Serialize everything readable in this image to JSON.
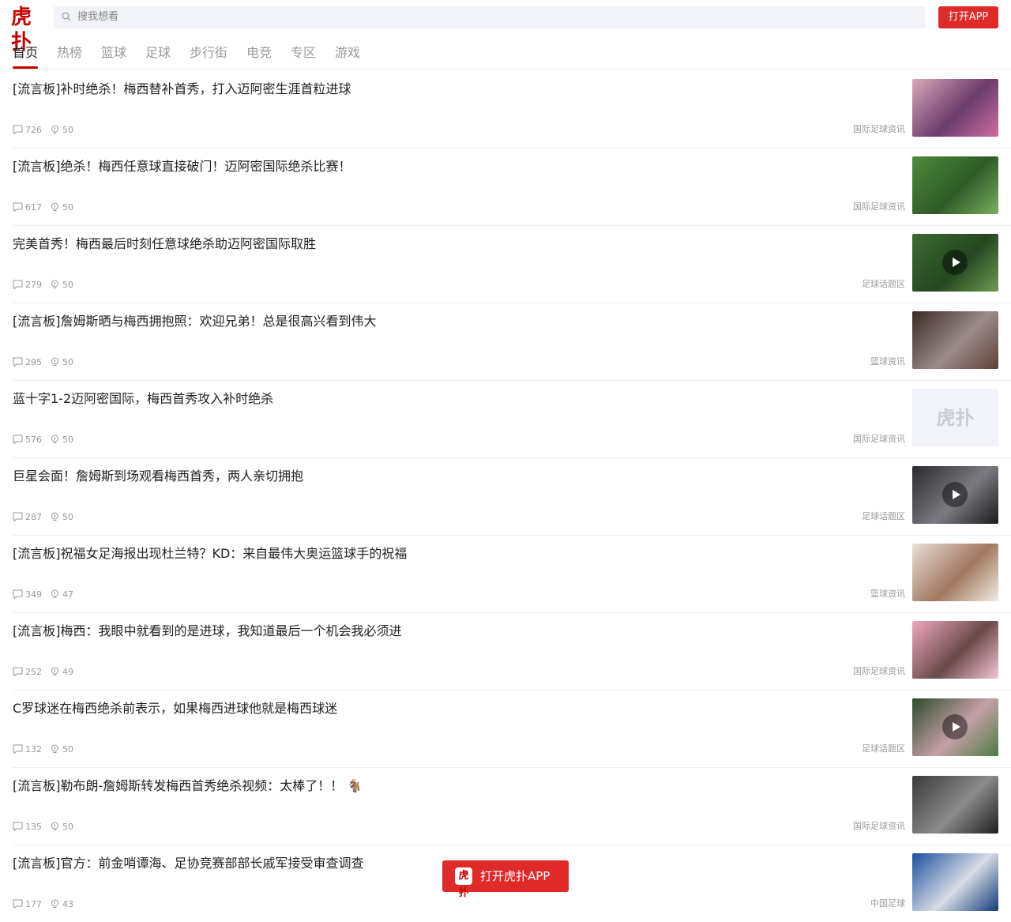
{
  "header": {
    "logo_text": "虎扑",
    "search_placeholder": "搜我想看",
    "open_app_label": "打开APP"
  },
  "tabs": [
    {
      "label": "首页",
      "active": true
    },
    {
      "label": "热榜"
    },
    {
      "label": "篮球"
    },
    {
      "label": "足球"
    },
    {
      "label": "步行街"
    },
    {
      "label": "电竞"
    },
    {
      "label": "专区"
    },
    {
      "label": "游戏"
    }
  ],
  "feed": [
    {
      "title": "[流言板]补时绝杀！梅西替补首秀，打入迈阿密生涯首粒进球",
      "comments": "726",
      "lights": "50",
      "source": "国际足球资讯",
      "thumb": {
        "colors": [
          "#d9a9b8",
          "#6a3c6b",
          "#ce6fa0"
        ],
        "video": false
      }
    },
    {
      "title": "[流言板]绝杀！梅西任意球直接破门！迈阿密国际绝杀比赛！",
      "comments": "617",
      "lights": "50",
      "source": "国际足球资讯",
      "thumb": {
        "colors": [
          "#4f8a3c",
          "#2f5a28",
          "#7cae5c"
        ],
        "video": false
      }
    },
    {
      "title": "完美首秀！梅西最后时刻任意球绝杀助迈阿密国际取胜",
      "comments": "279",
      "lights": "50",
      "source": "足球话题区",
      "thumb": {
        "colors": [
          "#3d6b34",
          "#254620",
          "#6e9a52"
        ],
        "video": true
      }
    },
    {
      "title": "[流言板]詹姆斯晒与梅西拥抱照：欢迎兄弟！总是很高兴看到伟大",
      "comments": "295",
      "lights": "50",
      "source": "篮球资讯",
      "thumb": {
        "colors": [
          "#3b2a24",
          "#9a8a8a",
          "#5c4236"
        ],
        "video": false
      }
    },
    {
      "title": "蓝十字1-2迈阿密国际，梅西首秀攻入补时绝杀",
      "comments": "576",
      "lights": "50",
      "source": "国际足球资讯",
      "thumb": {
        "colors": [
          "#f1f3f8",
          "#f1f3f8",
          "#f1f3f8"
        ],
        "video": false,
        "placeholder": "虎扑"
      }
    },
    {
      "title": "巨星会面！詹姆斯到场观看梅西首秀，两人亲切拥抱",
      "comments": "287",
      "lights": "50",
      "source": "足球话题区",
      "thumb": {
        "colors": [
          "#2a2a2e",
          "#7a7a80",
          "#1b1b1e"
        ],
        "video": true
      }
    },
    {
      "title": "[流言板]祝福女足海报出现杜兰特？KD：来自最伟大奥运篮球手的祝福",
      "comments": "349",
      "lights": "47",
      "source": "篮球资讯",
      "thumb": {
        "colors": [
          "#e8e0d4",
          "#a07860",
          "#f2ece4"
        ],
        "video": false
      }
    },
    {
      "title": "[流言板]梅西：我眼中就看到的是进球，我知道最后一个机会我必须进",
      "comments": "252",
      "lights": "49",
      "source": "国际足球资讯",
      "thumb": {
        "colors": [
          "#f0a8c0",
          "#6a4a4a",
          "#f6c6d6"
        ],
        "video": false
      }
    },
    {
      "title": "C罗球迷在梅西绝杀前表示，如果梅西进球他就是梅西球迷",
      "comments": "132",
      "lights": "50",
      "source": "足球话题区",
      "thumb": {
        "colors": [
          "#2e4a2a",
          "#c4a0a8",
          "#4e7a44"
        ],
        "video": true
      }
    },
    {
      "title": "[流言板]勒布朗-詹姆斯转发梅西首秀绝杀视频：太棒了！！ 🐐",
      "comments": "135",
      "lights": "50",
      "source": "国际足球资讯",
      "thumb": {
        "colors": [
          "#3a3a3a",
          "#8a8a8a",
          "#1e1e1e"
        ],
        "video": false
      }
    },
    {
      "title": "[流言板]官方：前金哨谭海、足协竞赛部部长戚军接受审查调查",
      "comments": "177",
      "lights": "43",
      "source": "中国足球",
      "thumb": {
        "colors": [
          "#1a4fa0",
          "#d8dce4",
          "#123a7a"
        ],
        "video": false
      }
    }
  ],
  "floating_button": {
    "logo_text": "虎扑",
    "label": "打开虎扑APP"
  }
}
